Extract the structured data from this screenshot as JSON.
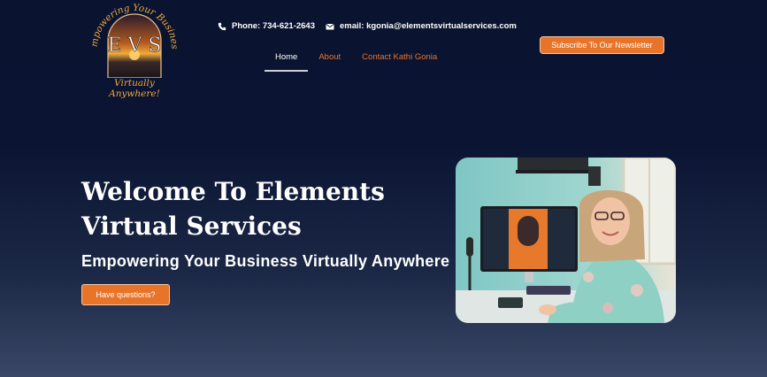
{
  "logo": {
    "arc_text": "Empowering Your Business",
    "monogram": "E V S",
    "tagline": "Virtually Anywhere!"
  },
  "contact": {
    "phone": "Phone: 734-621-2643",
    "email": "email: kgonia@elementsvirtualservices.com"
  },
  "nav": {
    "items": [
      {
        "label": "Home",
        "active": true
      },
      {
        "label": "About",
        "active": false
      },
      {
        "label": "Contact Kathi Gonia",
        "active": false
      }
    ]
  },
  "subscribe_label": "Subscribe To Our Newsletter",
  "hero": {
    "title": "Welcome To Elements Virtual Services",
    "subtitle": "Empowering Your Business Virtually Anywhere",
    "cta_label": "Have questions?"
  },
  "colors": {
    "accent": "#e8742a",
    "background": "#0a1330",
    "logo_gold": "#f2a93b"
  }
}
